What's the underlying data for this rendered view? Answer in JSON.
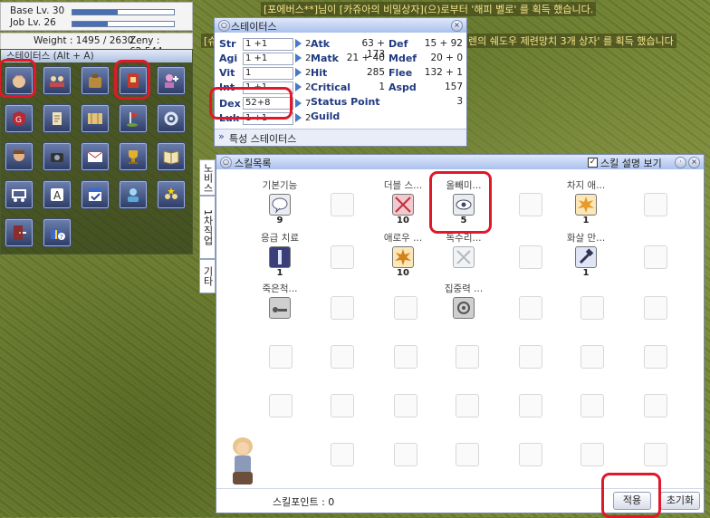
{
  "level": {
    "base_label": "Base Lv. 30",
    "job_label": "Job Lv. 26",
    "base_progress": 0.45,
    "job_progress": 0.35
  },
  "weight_text": "Weight : 1495 / 2630",
  "zeny_text": "Zeny : 62,544",
  "shortcuts": {
    "title": "스테이터스 (Alt + A)"
  },
  "system_messages": [
    "[포에버스**]님이 [카쥬아의 비밀상자](으)로부터 '해피 벨로' 를 획득 했습니다.",
    "[슈",
    "렌의 쉐도우 제련망치 3개 상자' 를 획득 했습니다"
  ],
  "status_window": {
    "title": "스테이터스",
    "stats": [
      {
        "label": "Str",
        "value": "1 +1",
        "cost": "2"
      },
      {
        "label": "Agi",
        "value": "1 +1",
        "cost": "2"
      },
      {
        "label": "Vit",
        "value": "1",
        "cost": "2"
      },
      {
        "label": "Int",
        "value": "1 +1",
        "cost": "2"
      },
      {
        "label": "Dex",
        "value": "52+8",
        "cost": "7"
      },
      {
        "label": "Luk",
        "value": "1 +1",
        "cost": "2"
      }
    ],
    "col2": [
      {
        "label": "Atk",
        "value": "63 + 173"
      },
      {
        "label": "Matk",
        "value": "21 + 40"
      },
      {
        "label": "Hit",
        "value": "285"
      },
      {
        "label": "Critical",
        "value": "1"
      },
      {
        "label": "Status Point",
        "value": "3"
      },
      {
        "label": "Guild",
        "value": ""
      }
    ],
    "col3": [
      {
        "label": "Def",
        "value": "15 + 92"
      },
      {
        "label": "Mdef",
        "value": "20 + 0"
      },
      {
        "label": "Flee",
        "value": "132 + 1"
      },
      {
        "label": "Aspd",
        "value": "157"
      }
    ],
    "special_status_label": "특성 스테이터스"
  },
  "skill_window": {
    "title": "스킬목록",
    "show_desc_label": "스킬 설명 보기",
    "tabs": [
      "노비스",
      "1차직업",
      "기타"
    ],
    "skills": [
      {
        "name": "기본기능",
        "level": "9"
      },
      {
        "name": "더블 스...",
        "level": "10"
      },
      {
        "name": "올빼미...",
        "level": "5"
      },
      {
        "name": "차지 애...",
        "level": "1"
      },
      {
        "name": "응급 치료",
        "level": "1"
      },
      {
        "name": "애로우 ...",
        "level": "10"
      },
      {
        "name": "독수리...",
        "level": ""
      },
      {
        "name": "화살 만...",
        "level": "1"
      },
      {
        "name": "죽은척...",
        "level": ""
      },
      {
        "name": "집중력 ...",
        "level": ""
      }
    ],
    "skill_points_label": "스킬포인트 : 0",
    "apply_button": "적용",
    "reset_button": "초기화"
  }
}
